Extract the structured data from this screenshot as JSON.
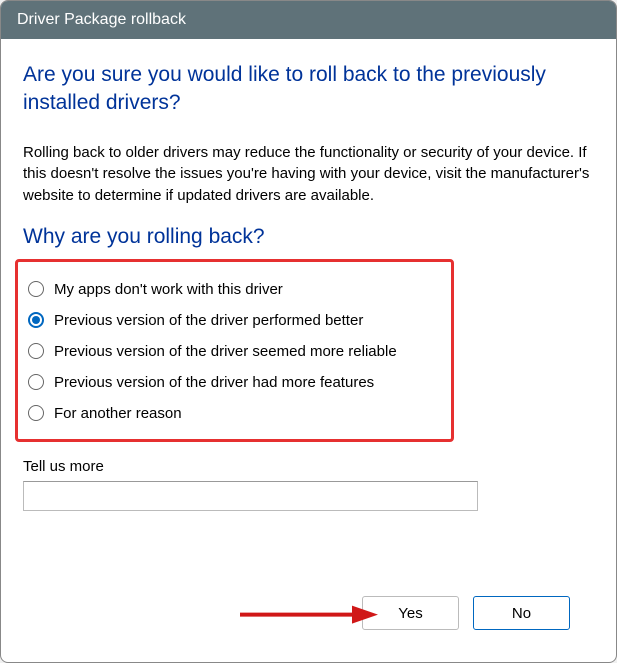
{
  "window": {
    "title": "Driver Package rollback"
  },
  "heading": "Are you sure you would like to roll back to the previously installed drivers?",
  "body": "Rolling back to older drivers may reduce the functionality or security of your device.  If this doesn't resolve the issues you're having with your device, visit the manufacturer's website to determine if updated drivers are available.",
  "subheading": "Why are you rolling back?",
  "reasons": [
    {
      "label": "My apps don't work with this driver",
      "checked": false
    },
    {
      "label": "Previous version of the driver performed better",
      "checked": true
    },
    {
      "label": "Previous version of the driver seemed more reliable",
      "checked": false
    },
    {
      "label": "Previous version of the driver had more features",
      "checked": false
    },
    {
      "label": "For another reason",
      "checked": false
    }
  ],
  "tellmore": {
    "label": "Tell us more",
    "value": ""
  },
  "buttons": {
    "yes": "Yes",
    "no": "No"
  },
  "annotation": {
    "highlight_color": "#e63030",
    "arrow_color": "#d01818"
  }
}
